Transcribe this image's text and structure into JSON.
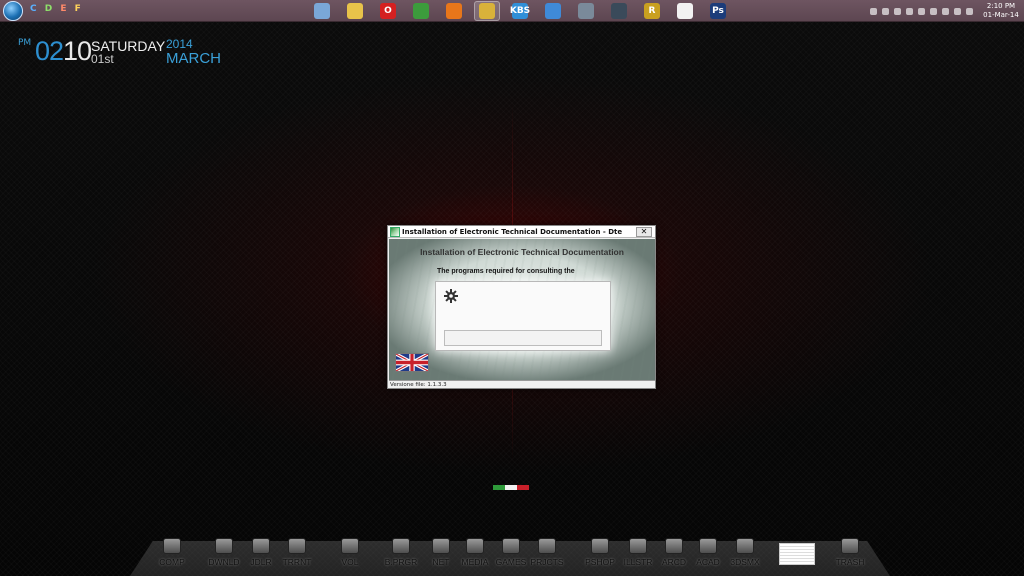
{
  "taskbar": {
    "drives": [
      "C",
      "D",
      "E",
      "F"
    ],
    "apps": [
      {
        "id": "photo-viewer",
        "glyph": "",
        "color": "#7aa7d8"
      },
      {
        "id": "file-explorer",
        "glyph": "",
        "color": "#e8c34a"
      },
      {
        "id": "opera",
        "glyph": "O",
        "color": "#d42020"
      },
      {
        "id": "chrome",
        "glyph": "",
        "color": "#3c9b3c"
      },
      {
        "id": "firefox",
        "glyph": "",
        "color": "#e8761a"
      },
      {
        "id": "pen-tool",
        "glyph": "",
        "color": "#d9b23a"
      },
      {
        "id": "kbs",
        "glyph": "KBS",
        "color": "#2f8fd8"
      },
      {
        "id": "itunes",
        "glyph": "",
        "color": "#3f8ad8"
      },
      {
        "id": "media-player",
        "glyph": "",
        "color": "#7a8a9a"
      },
      {
        "id": "steam",
        "glyph": "",
        "color": "#3a4a5a"
      },
      {
        "id": "r-app",
        "glyph": "R",
        "color": "#c9a020"
      },
      {
        "id": "setup-app",
        "glyph": "",
        "color": "#f2f2f2"
      },
      {
        "id": "photoshop",
        "glyph": "Ps",
        "color": "#1c3c7a"
      }
    ],
    "clock": {
      "time": "2:10 PM",
      "date": "01-Mar-14"
    }
  },
  "widget": {
    "ampm": "PM",
    "hour": "02",
    "minute": "10",
    "day": "SATURDAY",
    "date": "01st",
    "year": "2014",
    "month": "MARCH"
  },
  "dialog": {
    "title": "Installation of Electronic Technical Documentation - Dte",
    "close_label": "✕",
    "heading": "Installation of Electronic Technical Documentation",
    "subtitle": "The programs required for consulting the",
    "footer": "Versione file: 1.1.3.3"
  },
  "dock": {
    "items": [
      "COMP",
      "DWNLD",
      "JDLR",
      "TRRNT",
      "VOL",
      "B.PRGR",
      "NET",
      "MEDIA",
      "GAMES",
      "PRJCTS",
      "PSHOP",
      "ILLSTR",
      "ARCD",
      "ACAD",
      "3DSMX",
      "TRASH"
    ]
  },
  "colors": {
    "accent_blue": "#2d8fd0",
    "taskbar": "#6e5561",
    "flag_green": "#2e9a3a",
    "flag_white": "#f2f2f2",
    "flag_red": "#c8202a"
  }
}
